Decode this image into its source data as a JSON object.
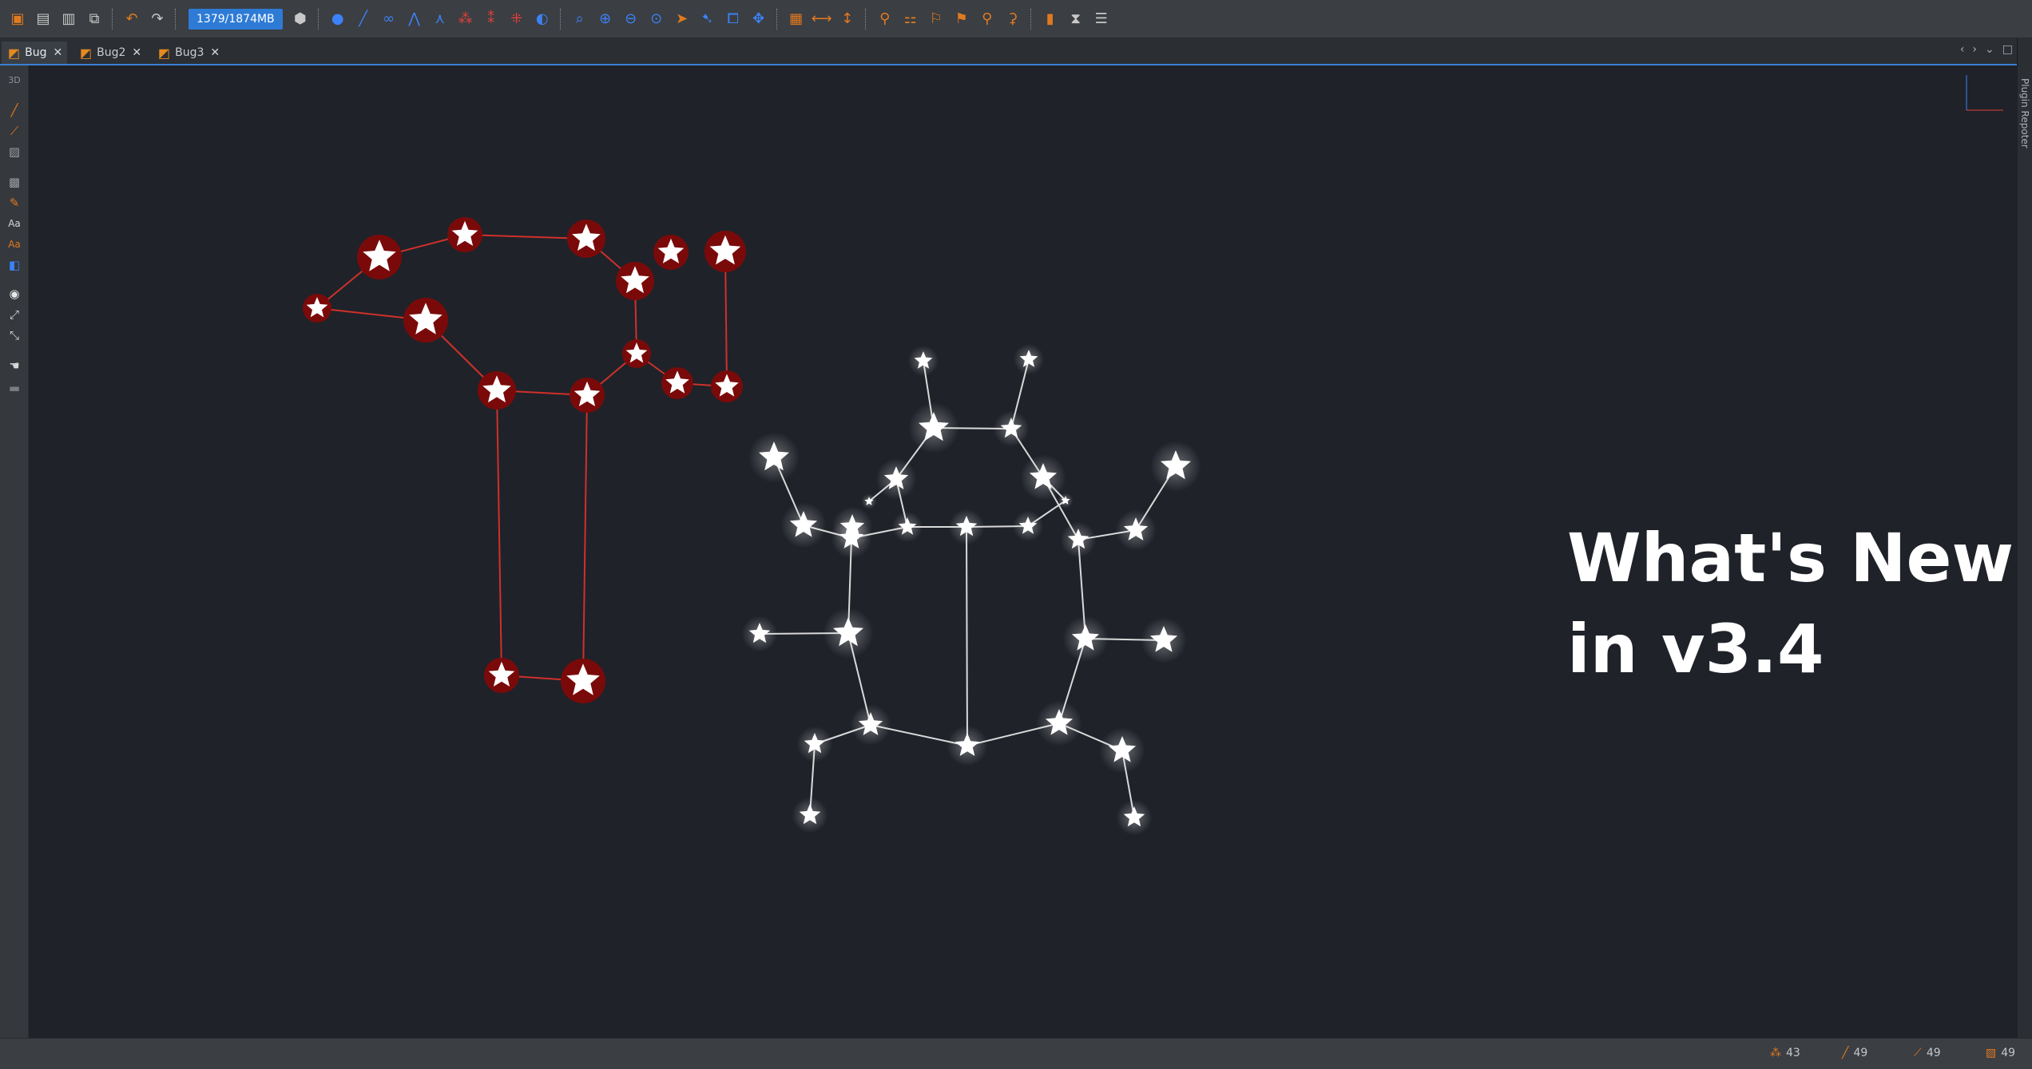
{
  "toolbar": {
    "memory": "1379/1874MB",
    "icons": [
      "new-project-icon",
      "open-icon",
      "save-icon",
      "copy-icon",
      "undo-icon",
      "redo-icon",
      "gc-icon",
      "node-icon",
      "edge-icon",
      "layout-icon",
      "graph-icon",
      "zoom-fit-icon",
      "zoom-in-icon",
      "zoom-out-icon",
      "select-icon",
      "grid-icon",
      "filter-icon",
      "stats-icon",
      "timeline-icon",
      "database-icon"
    ]
  },
  "tabs": [
    {
      "label": "Bug",
      "active": true
    },
    {
      "label": "Bug2",
      "active": false
    },
    {
      "label": "Bug3",
      "active": false
    }
  ],
  "left_tools": {
    "mode_label": "3D"
  },
  "right_panel": {
    "label": "Plugin Repoter"
  },
  "canvas": {
    "headline_line1": "What's New",
    "headline_line2": "in v3.4",
    "colors": {
      "background": "#1f2229",
      "red_node": "#7a0a0a",
      "red_edge": "#d0302a",
      "white_node": "#ffffff",
      "white_edge": "#d9d9d9"
    }
  },
  "statusbar": {
    "nodes": "43",
    "edges": "49",
    "stat3": "49",
    "stat4": "49"
  }
}
